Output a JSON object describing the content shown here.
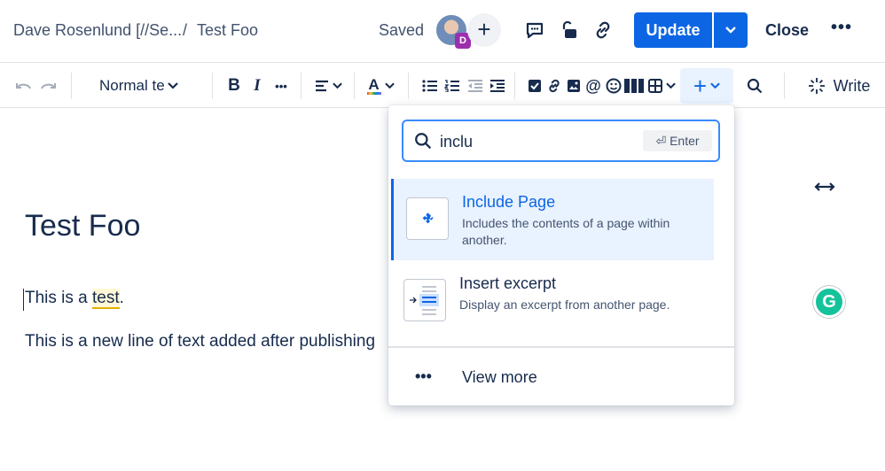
{
  "header": {
    "breadcrumb_space": "Dave Rosenlund [//Se...",
    "breadcrumb_sep": "/",
    "breadcrumb_page": "Test Foo",
    "saved_label": "Saved",
    "avatar_badge": "D",
    "update_label": "Update",
    "close_label": "Close",
    "more": "•••"
  },
  "toolbar": {
    "text_style": "Normal te",
    "bold": "B",
    "italic": "I",
    "more": "•••",
    "text_color": "A",
    "write_label": "Write"
  },
  "editor": {
    "title": "Test Foo",
    "line1_before": "This is a ",
    "line1_highlight": "test",
    "line1_after": ".",
    "line2": "This is a new line of text added after publishing"
  },
  "insert_menu": {
    "search_value": "inclu",
    "enter_hint": "Enter",
    "items": [
      {
        "title": "Include Page",
        "description": "Includes the contents of a page within another.",
        "icon": "puzzle-icon",
        "selected": true
      },
      {
        "title": "Insert excerpt",
        "description": "Display an excerpt from another page.",
        "icon": "excerpt-icon",
        "selected": false
      }
    ],
    "view_more_label": "View more"
  },
  "colors": {
    "accent": "#0c66e4",
    "selected_bg": "#e9f2ff",
    "text": "#172b4d",
    "grammarly": "#15c39a",
    "badge": "#9b2fae"
  }
}
